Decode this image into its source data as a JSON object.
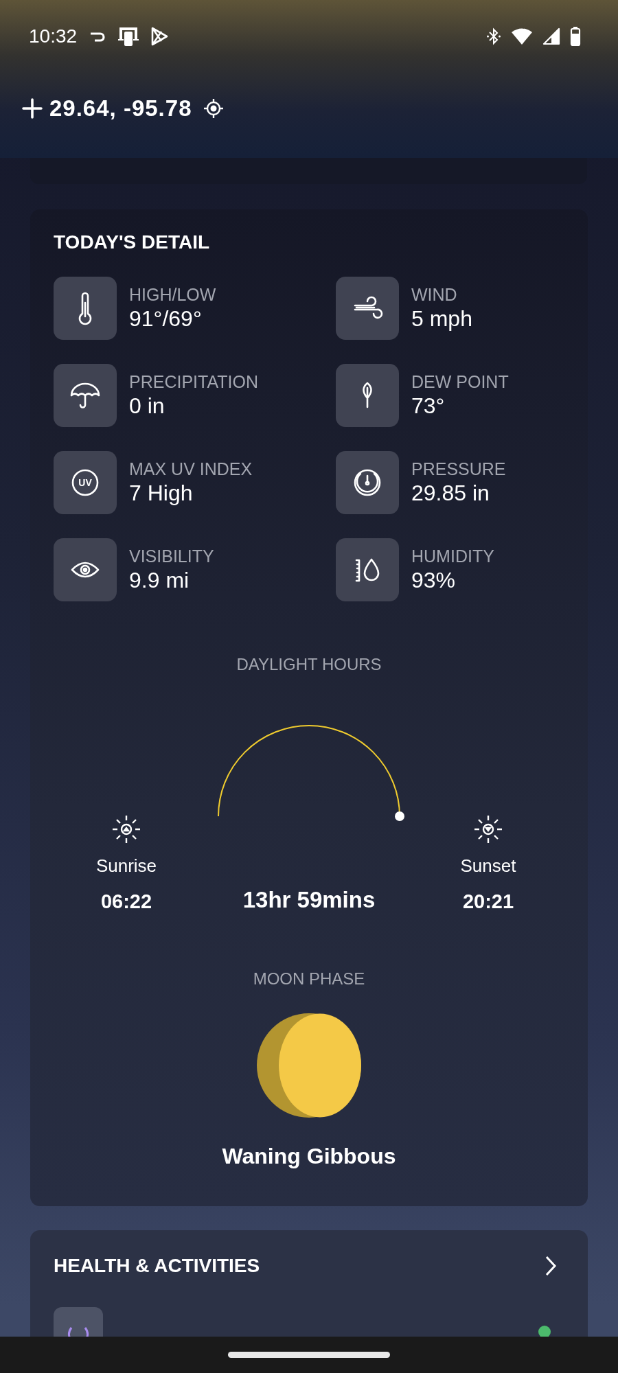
{
  "status_bar": {
    "time": "10:32"
  },
  "location": {
    "coordinates": "29.64, -95.78"
  },
  "todays_detail": {
    "title": "TODAY'S DETAIL",
    "items": [
      {
        "label": "HIGH/LOW",
        "value": "91°/69°"
      },
      {
        "label": "WIND",
        "value": "5 mph"
      },
      {
        "label": "PRECIPITATION",
        "value": "0 in"
      },
      {
        "label": "DEW POINT",
        "value": "73°"
      },
      {
        "label": "MAX UV INDEX",
        "value": "7 High",
        "icon_text": "UV"
      },
      {
        "label": "PRESSURE",
        "value": "29.85 in"
      },
      {
        "label": "VISIBILITY",
        "value": "9.9 mi"
      },
      {
        "label": "HUMIDITY",
        "value": "93%"
      }
    ],
    "daylight": {
      "title": "DAYLIGHT HOURS",
      "sunrise_label": "Sunrise",
      "sunrise_time": "06:22",
      "duration": "13hr 59mins",
      "sunset_label": "Sunset",
      "sunset_time": "20:21"
    },
    "moon": {
      "title": "MOON PHASE",
      "phase": "Waning Gibbous"
    }
  },
  "health": {
    "title": "HEALTH & ACTIVITIES",
    "items": [
      {
        "color": "#4cbb6c"
      }
    ]
  }
}
